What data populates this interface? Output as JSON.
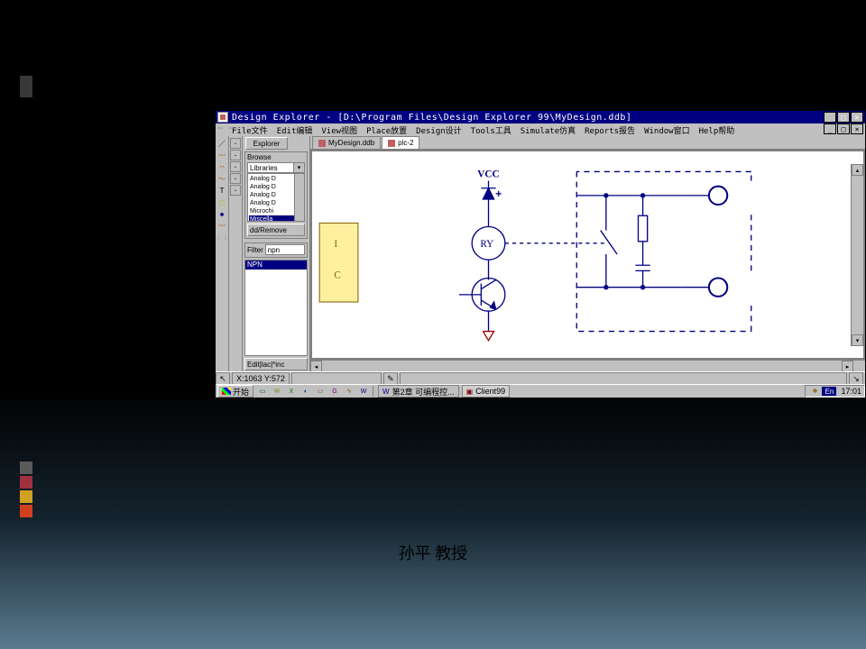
{
  "slide": {
    "footer_text": "孙平 教授",
    "bar_colors": [
      "#383838",
      "#383838",
      "#383838",
      "#383838",
      "#383838",
      "#383838"
    ],
    "bar_colors2": [
      "#5a5a5a",
      "#a03040",
      "#d0a020",
      "#d04020"
    ]
  },
  "app": {
    "title": "Design Explorer - [D:\\Program Files\\Design Explorer 99\\MyDesign.ddb]",
    "win_buttons": [
      "_",
      "□",
      "×"
    ],
    "doc_buttons": [
      "_",
      "□",
      "×"
    ],
    "menus": [
      "File文件",
      "Edit编辑",
      "View视图",
      "Place放置",
      "Design设计",
      "Tools工具",
      "Simulate仿真",
      "Reports报告",
      "Window窗口",
      "Help帮助"
    ],
    "tool_col1": [
      "／",
      "〰",
      "⌒",
      "〜",
      "T",
      "□",
      "◆",
      "〰",
      "⋮⋮"
    ],
    "tool_col1_colors": [
      "#000080",
      "#a06000",
      "#a06000",
      "#a06000",
      "#000",
      "#c0c000",
      "#000080",
      "#a06000",
      "#808080"
    ],
    "tool_col2": [
      "·",
      "·",
      "·",
      "·",
      "·"
    ],
    "explorer": {
      "tab": "Explorer",
      "browse_label": "Browse",
      "libraries_combo": "Libraries",
      "lib_items": [
        "Analog D",
        "Analog D",
        "Analog D",
        "Analog D",
        "Microchi",
        "Miscella"
      ],
      "lib_selected_index": 5,
      "addremove_btn": "dd/Remove",
      "filter_label": "Filter",
      "filter_value": "npn",
      "result_items": [
        "NPN"
      ],
      "result_selected_index": 0,
      "bottom_btn": "Edit|lac|*inc"
    },
    "doc_tabs": [
      {
        "label": "MyDesign.ddb",
        "active": false
      },
      {
        "label": "plc-2",
        "active": true
      }
    ],
    "schematic": {
      "vcc_label": "VCC",
      "ry_label": "RY",
      "comp_box": {
        "line1": "I",
        "line2": "C"
      }
    },
    "status": {
      "coords": "X:1063 Y:572"
    }
  },
  "taskbar": {
    "start": "开始",
    "quicklaunch": [
      "▭",
      "✉",
      "X",
      "◐",
      "▭",
      "G",
      "ϟ",
      "W"
    ],
    "quicklaunch_colors": [
      "#006000",
      "#808000",
      "#008000",
      "#004080",
      "#606060",
      "#800080",
      "#806000",
      "#000080"
    ],
    "tasks": [
      {
        "label": "第2章  可编程控...",
        "pressed": false,
        "icon": "W",
        "icon_color": "#000080"
      },
      {
        "label": "Client99",
        "pressed": true,
        "icon": "▣",
        "icon_color": "#800000"
      }
    ],
    "tray_icons": [
      "❖"
    ],
    "lang": "En",
    "clock": "17:01"
  }
}
